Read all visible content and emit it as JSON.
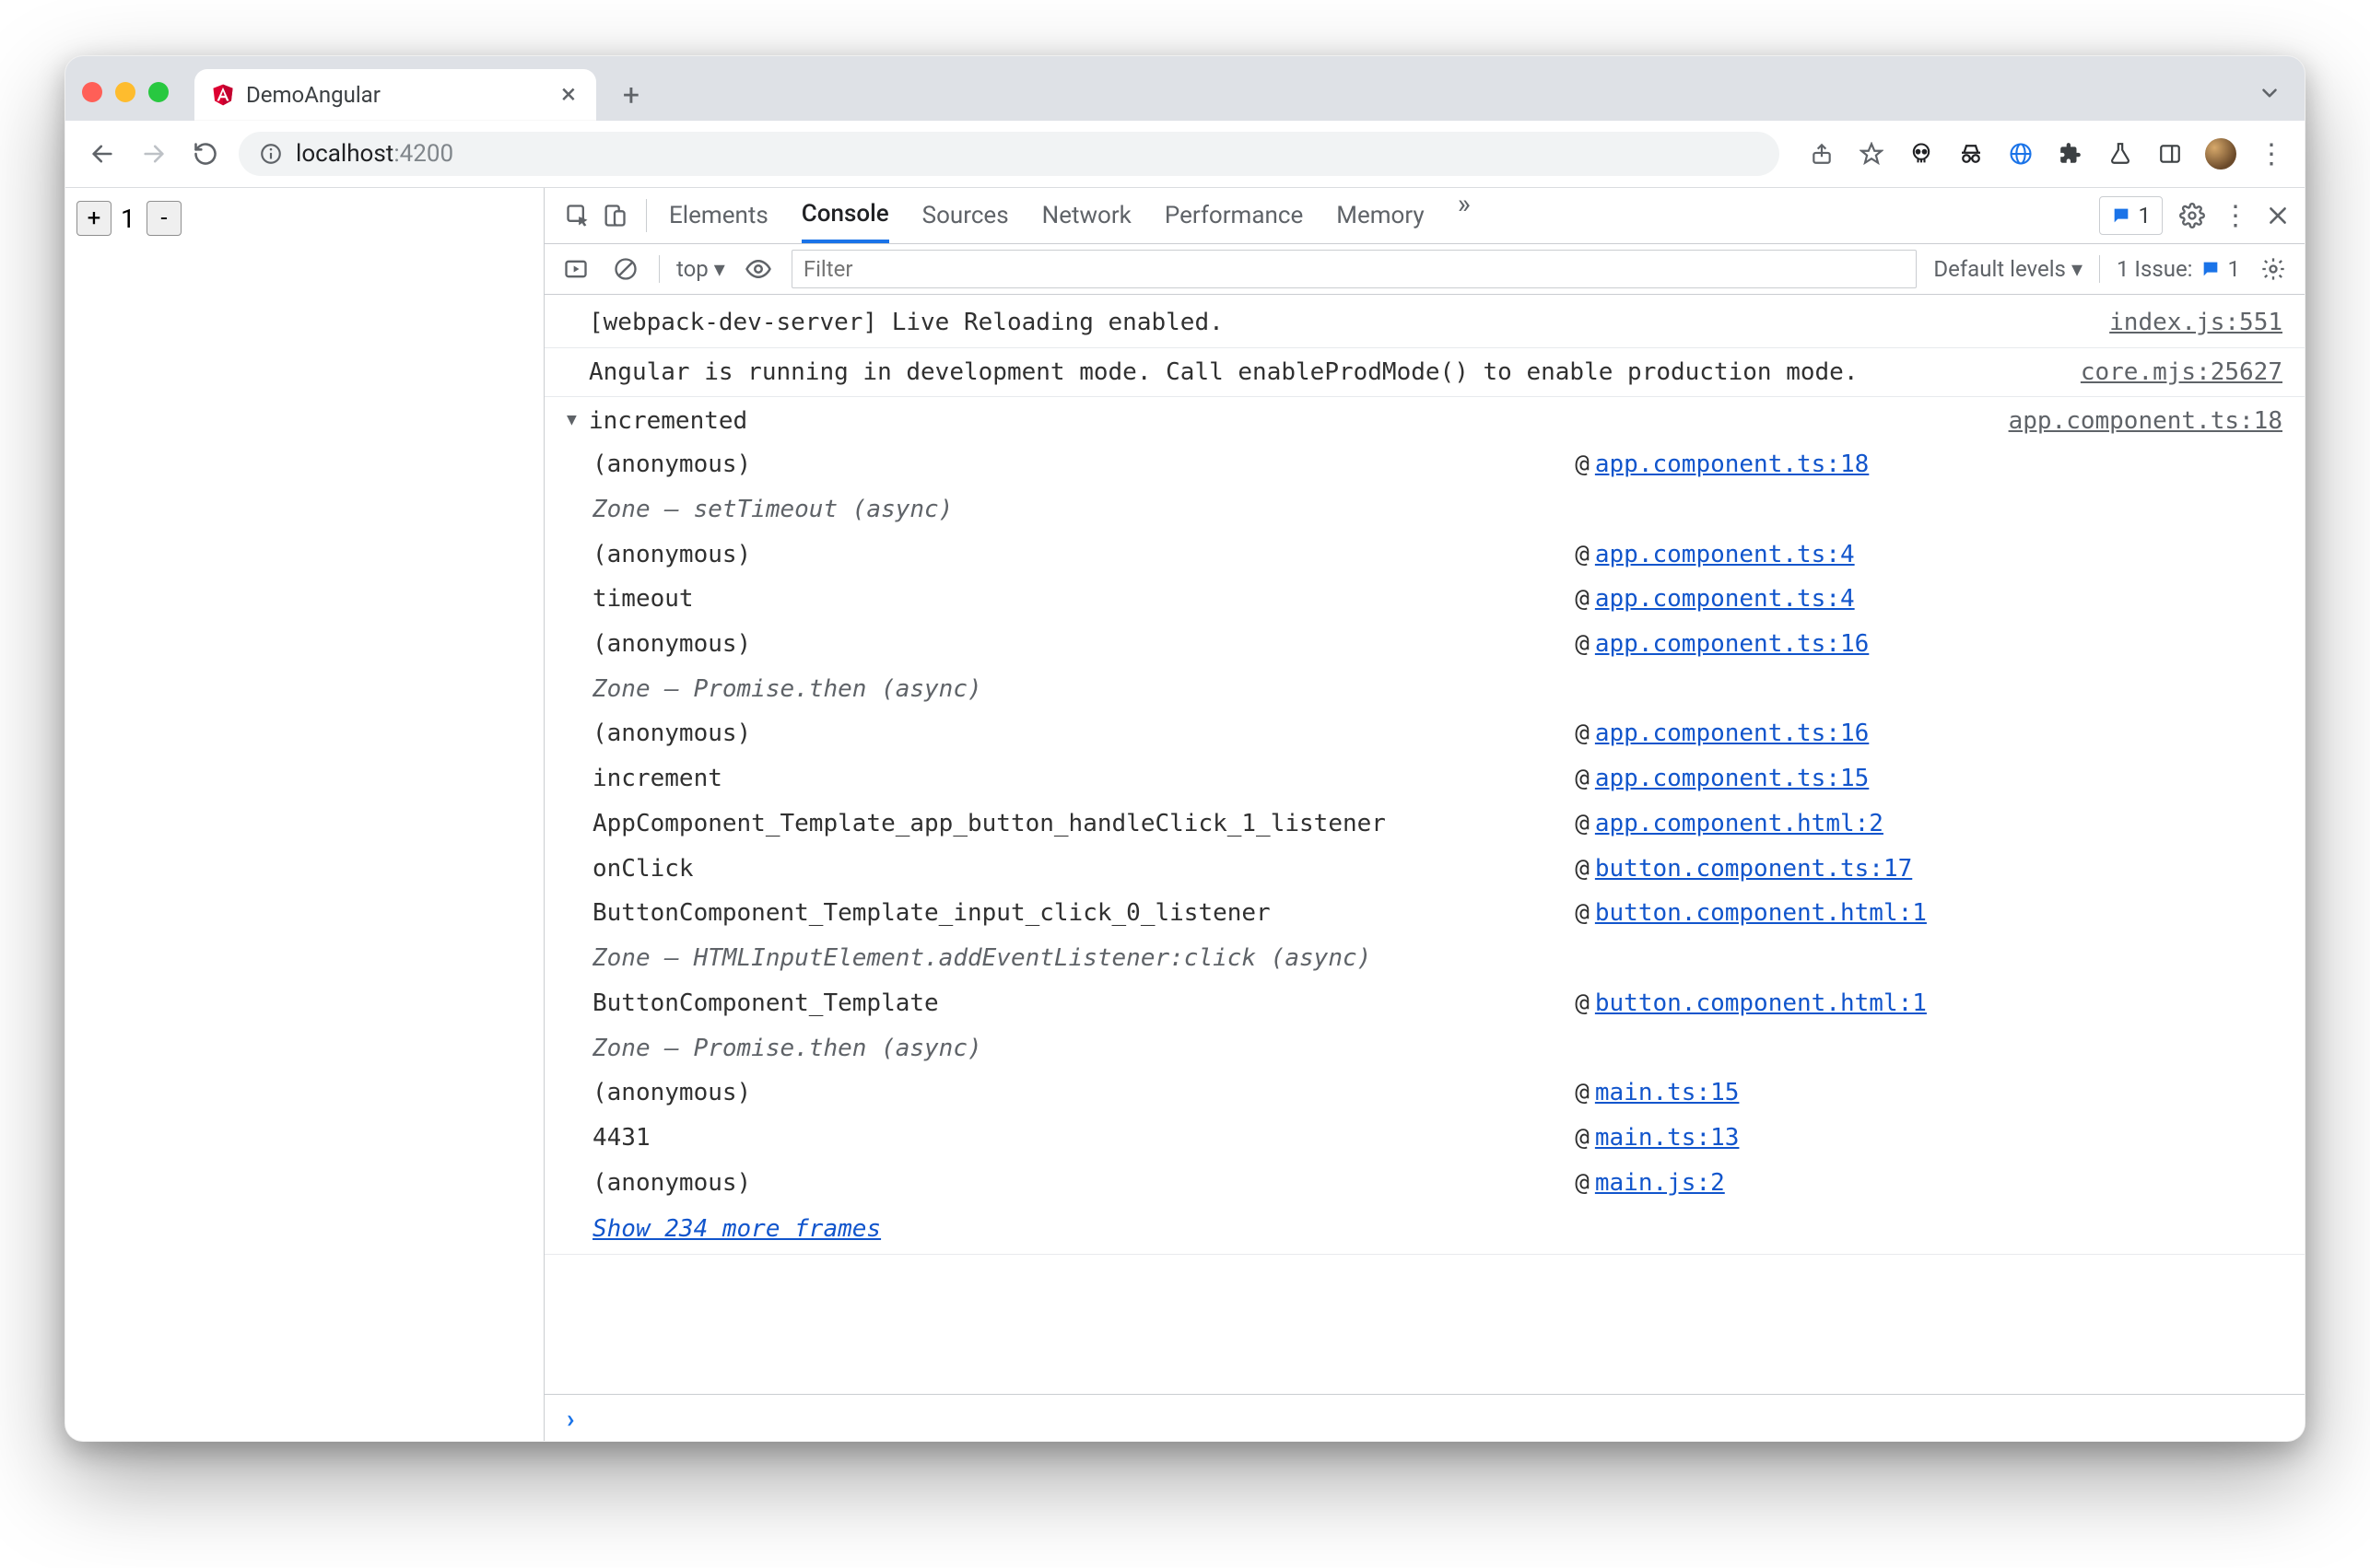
{
  "browser": {
    "tab_title": "DemoAngular",
    "url_host": "localhost",
    "url_path": ":4200",
    "new_tab_glyph": "+",
    "close_glyph": "×",
    "chevron_glyph": "⌄",
    "more_glyph": "⋮"
  },
  "page": {
    "plus": "+",
    "minus": "-",
    "counter": "1"
  },
  "devtools": {
    "tabs": [
      "Elements",
      "Console",
      "Sources",
      "Network",
      "Performance",
      "Memory"
    ],
    "overflow_glyph": "»",
    "messages_count": "1",
    "issues_label": "1 Issue:",
    "issues_count": "1",
    "subbar": {
      "context": "top",
      "dropdown_glyph": "▾",
      "filter_placeholder": "Filter",
      "levels_label": "Default levels",
      "levels_glyph": "▾"
    }
  },
  "console": {
    "rows": [
      {
        "msg": "[webpack-dev-server] Live Reloading enabled.",
        "src": "index.js:551"
      },
      {
        "msg": "Angular is running in development mode. Call enableProdMode() to enable production mode.",
        "src": "core.mjs:25627"
      }
    ],
    "trace": {
      "label": "incremented",
      "src": "app.component.ts:18",
      "frames": [
        {
          "fn": "(anonymous)",
          "loc": "app.component.ts:18"
        },
        {
          "async": "Zone – setTimeout (async)"
        },
        {
          "fn": "(anonymous)",
          "loc": "app.component.ts:4"
        },
        {
          "fn": "timeout",
          "loc": "app.component.ts:4"
        },
        {
          "fn": "(anonymous)",
          "loc": "app.component.ts:16"
        },
        {
          "async": "Zone – Promise.then (async)"
        },
        {
          "fn": "(anonymous)",
          "loc": "app.component.ts:16"
        },
        {
          "fn": "increment",
          "loc": "app.component.ts:15"
        },
        {
          "fn": "AppComponent_Template_app_button_handleClick_1_listener",
          "loc": "app.component.html:2"
        },
        {
          "fn": "onClick",
          "loc": "button.component.ts:17"
        },
        {
          "fn": "ButtonComponent_Template_input_click_0_listener",
          "loc": "button.component.html:1"
        },
        {
          "async": "Zone – HTMLInputElement.addEventListener:click (async)"
        },
        {
          "fn": "ButtonComponent_Template",
          "loc": "button.component.html:1"
        },
        {
          "async": "Zone – Promise.then (async)"
        },
        {
          "fn": "(anonymous)",
          "loc": "main.ts:15"
        },
        {
          "fn": "4431",
          "loc": "main.ts:13"
        },
        {
          "fn": "(anonymous)",
          "loc": "main.js:2"
        }
      ],
      "more": "Show 234 more frames"
    },
    "prompt_glyph": "›"
  }
}
